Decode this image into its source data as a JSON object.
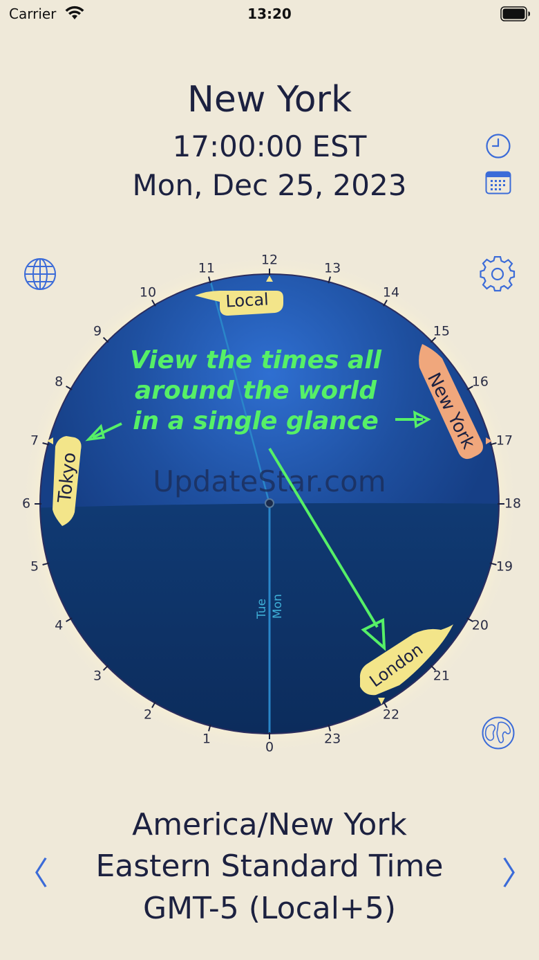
{
  "status_bar": {
    "carrier": "Carrier",
    "time": "13:20"
  },
  "header": {
    "city": "New York",
    "time": "17:00:00 EST",
    "date": "Mon, Dec 25, 2023"
  },
  "toolbar": {
    "icons": [
      "clock-icon",
      "calendar-icon",
      "globe-icon",
      "gear-icon",
      "world-map-icon"
    ]
  },
  "dial": {
    "hours": [
      "0",
      "1",
      "2",
      "3",
      "4",
      "5",
      "6",
      "7",
      "8",
      "9",
      "10",
      "11",
      "12",
      "13",
      "14",
      "15",
      "16",
      "17",
      "18",
      "19",
      "20",
      "21",
      "22",
      "23"
    ],
    "labels": {
      "local": "Local",
      "new_york": "New York",
      "tokyo": "Tokyo",
      "london": "London"
    },
    "day_labels": {
      "left": "Tue",
      "right": "Mon"
    },
    "annotation": [
      "View the times all",
      "around the world",
      "in a single glance"
    ],
    "watermark": "UpdateStar.com"
  },
  "footer": {
    "timezone": "America/New York",
    "zone_name": "Eastern Standard Time",
    "offset": "GMT-5 (Local+5)",
    "prev": "〈",
    "next": "〉"
  },
  "colors": {
    "background": "#efe9d9",
    "dial_day": "#1f4f9e",
    "dial_night": "#0e3266",
    "label_yellow": "#f3e58a",
    "label_orange": "#f0a77c",
    "annotation_green": "#56f067",
    "accent_blue": "#3b6bd8"
  }
}
